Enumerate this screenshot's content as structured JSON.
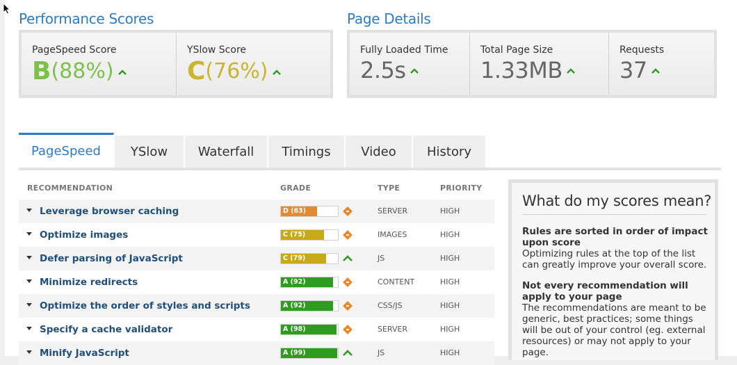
{
  "performance": {
    "title": "Performance Scores",
    "pagespeed": {
      "label": "PageSpeed Score",
      "grade": "B",
      "percent": "(88%)",
      "color": "#7cc24a"
    },
    "yslow": {
      "label": "YSlow Score",
      "grade": "C",
      "percent": "(76%)",
      "color": "#c9b530"
    }
  },
  "details": {
    "title": "Page Details",
    "loaded": {
      "label": "Fully Loaded Time",
      "value": "2.5s"
    },
    "size": {
      "label": "Total Page Size",
      "value": "1.33MB"
    },
    "requests": {
      "label": "Requests",
      "value": "37"
    }
  },
  "tabs": [
    "PageSpeed",
    "YSlow",
    "Waterfall",
    "Timings",
    "Video",
    "History"
  ],
  "active_tab": "PageSpeed",
  "table": {
    "headers": {
      "recommendation": "RECOMMENDATION",
      "grade": "GRADE",
      "type": "TYPE",
      "priority": "PRIORITY"
    },
    "rows": [
      {
        "name": "Leverage browser caching",
        "grade": "D (63)",
        "score": 63,
        "color": "#e8892b",
        "trend": "diamond",
        "type": "SERVER",
        "priority": "HIGH"
      },
      {
        "name": "Optimize images",
        "grade": "C (75)",
        "score": 75,
        "color": "#c8a918",
        "trend": "diamond",
        "type": "IMAGES",
        "priority": "HIGH"
      },
      {
        "name": "Defer parsing of JavaScript",
        "grade": "C (79)",
        "score": 79,
        "color": "#c8a918",
        "trend": "up",
        "type": "JS",
        "priority": "HIGH"
      },
      {
        "name": "Minimize redirects",
        "grade": "A (92)",
        "score": 92,
        "color": "#2e9c1f",
        "trend": "diamond",
        "type": "CONTENT",
        "priority": "HIGH"
      },
      {
        "name": "Optimize the order of styles and scripts",
        "grade": "A (92)",
        "score": 92,
        "color": "#2e9c1f",
        "trend": "diamond",
        "type": "CSS/JS",
        "priority": "HIGH"
      },
      {
        "name": "Specify a cache validator",
        "grade": "A (98)",
        "score": 98,
        "color": "#2e9c1f",
        "trend": "diamond",
        "type": "SERVER",
        "priority": "HIGH"
      },
      {
        "name": "Minify JavaScript",
        "grade": "A (99)",
        "score": 99,
        "color": "#2e9c1f",
        "trend": "up",
        "type": "JS",
        "priority": "HIGH"
      }
    ]
  },
  "sidebar": {
    "title": "What do my scores mean?",
    "p1_title": "Rules are sorted in order of impact upon score",
    "p1_text": "Optimizing rules at the top of the list can greatly improve your overall score.",
    "p2_title": "Not every recommendation will apply to your page",
    "p2_text": "The recommendations are meant to be generic, best practices; some things will be out of your control (eg. external resources) or may not apply to your page."
  }
}
